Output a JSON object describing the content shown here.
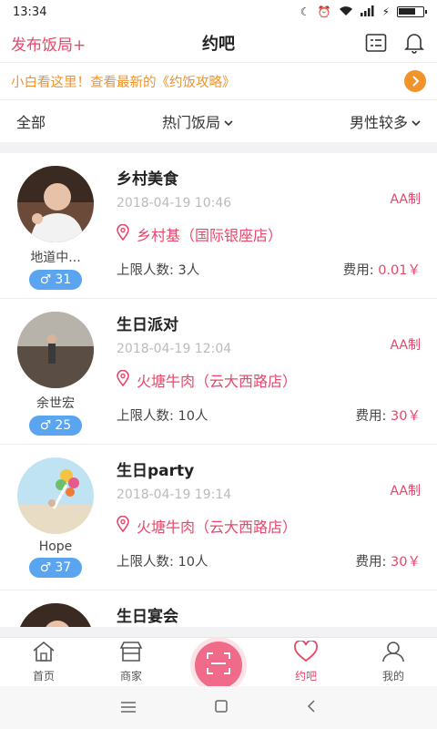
{
  "status": {
    "time": "13:34"
  },
  "header": {
    "publish_label": "发布饭局+",
    "title": "约吧"
  },
  "notice": {
    "text": "小白看这里！查看最新的《约饭攻略》"
  },
  "filters": [
    {
      "label": "全部"
    },
    {
      "label": "热门饭局"
    },
    {
      "label": "男性较多"
    }
  ],
  "events": [
    {
      "user": "地道中...",
      "count": "31",
      "title": "乡村美食",
      "time": "2018-04-19 10:46",
      "payment": "AA制",
      "location": "乡村基（国际银座店）",
      "limit_label": "上限人数: 3人",
      "fee_label": "费用: ",
      "fee_value": "0.01￥"
    },
    {
      "user": "余世宏",
      "count": "25",
      "title": "生日派对",
      "time": "2018-04-19 12:04",
      "payment": "AA制",
      "location": "火塘牛肉（云大西路店）",
      "limit_label": "上限人数: 10人",
      "fee_label": "费用: ",
      "fee_value": "30￥"
    },
    {
      "user": "Hope",
      "count": "37",
      "title": "生日party",
      "time": "2018-04-19 19:14",
      "payment": "AA制",
      "location": "火塘牛肉（云大西路店）",
      "limit_label": "上限人数: 10人",
      "fee_label": "费用: ",
      "fee_value": "30￥"
    },
    {
      "title": "生日宴会"
    }
  ],
  "tabs": [
    {
      "label": "首页"
    },
    {
      "label": "商家"
    },
    {
      "label": "约吧"
    },
    {
      "label": "我的"
    }
  ],
  "colors": {
    "accent": "#e9466a",
    "notice": "#f0932b",
    "badge": "#5aa4f0"
  }
}
